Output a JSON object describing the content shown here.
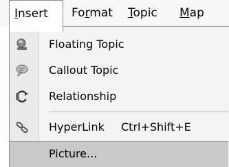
{
  "menubar": {
    "items": [
      {
        "mnemonic": "I",
        "rest": "nsert"
      },
      {
        "pre": "Fo",
        "mnemonic": "r",
        "rest": "mat"
      },
      {
        "mnemonic": "T",
        "rest": "opic"
      },
      {
        "mnemonic": "M",
        "rest": "ap"
      }
    ],
    "active_index": 0
  },
  "dropdown": {
    "items": [
      {
        "label": "Floating Topic",
        "icon": "floating-topic-icon"
      },
      {
        "label": "Callout Topic",
        "icon": "callout-topic-icon"
      },
      {
        "label": "Relationship",
        "icon": "relationship-icon"
      },
      {
        "label": "HyperLink",
        "shortcut": "Ctrl+Shift+E",
        "icon": "hyperlink-icon"
      },
      {
        "label": "Picture...",
        "highlighted": true
      }
    ]
  }
}
